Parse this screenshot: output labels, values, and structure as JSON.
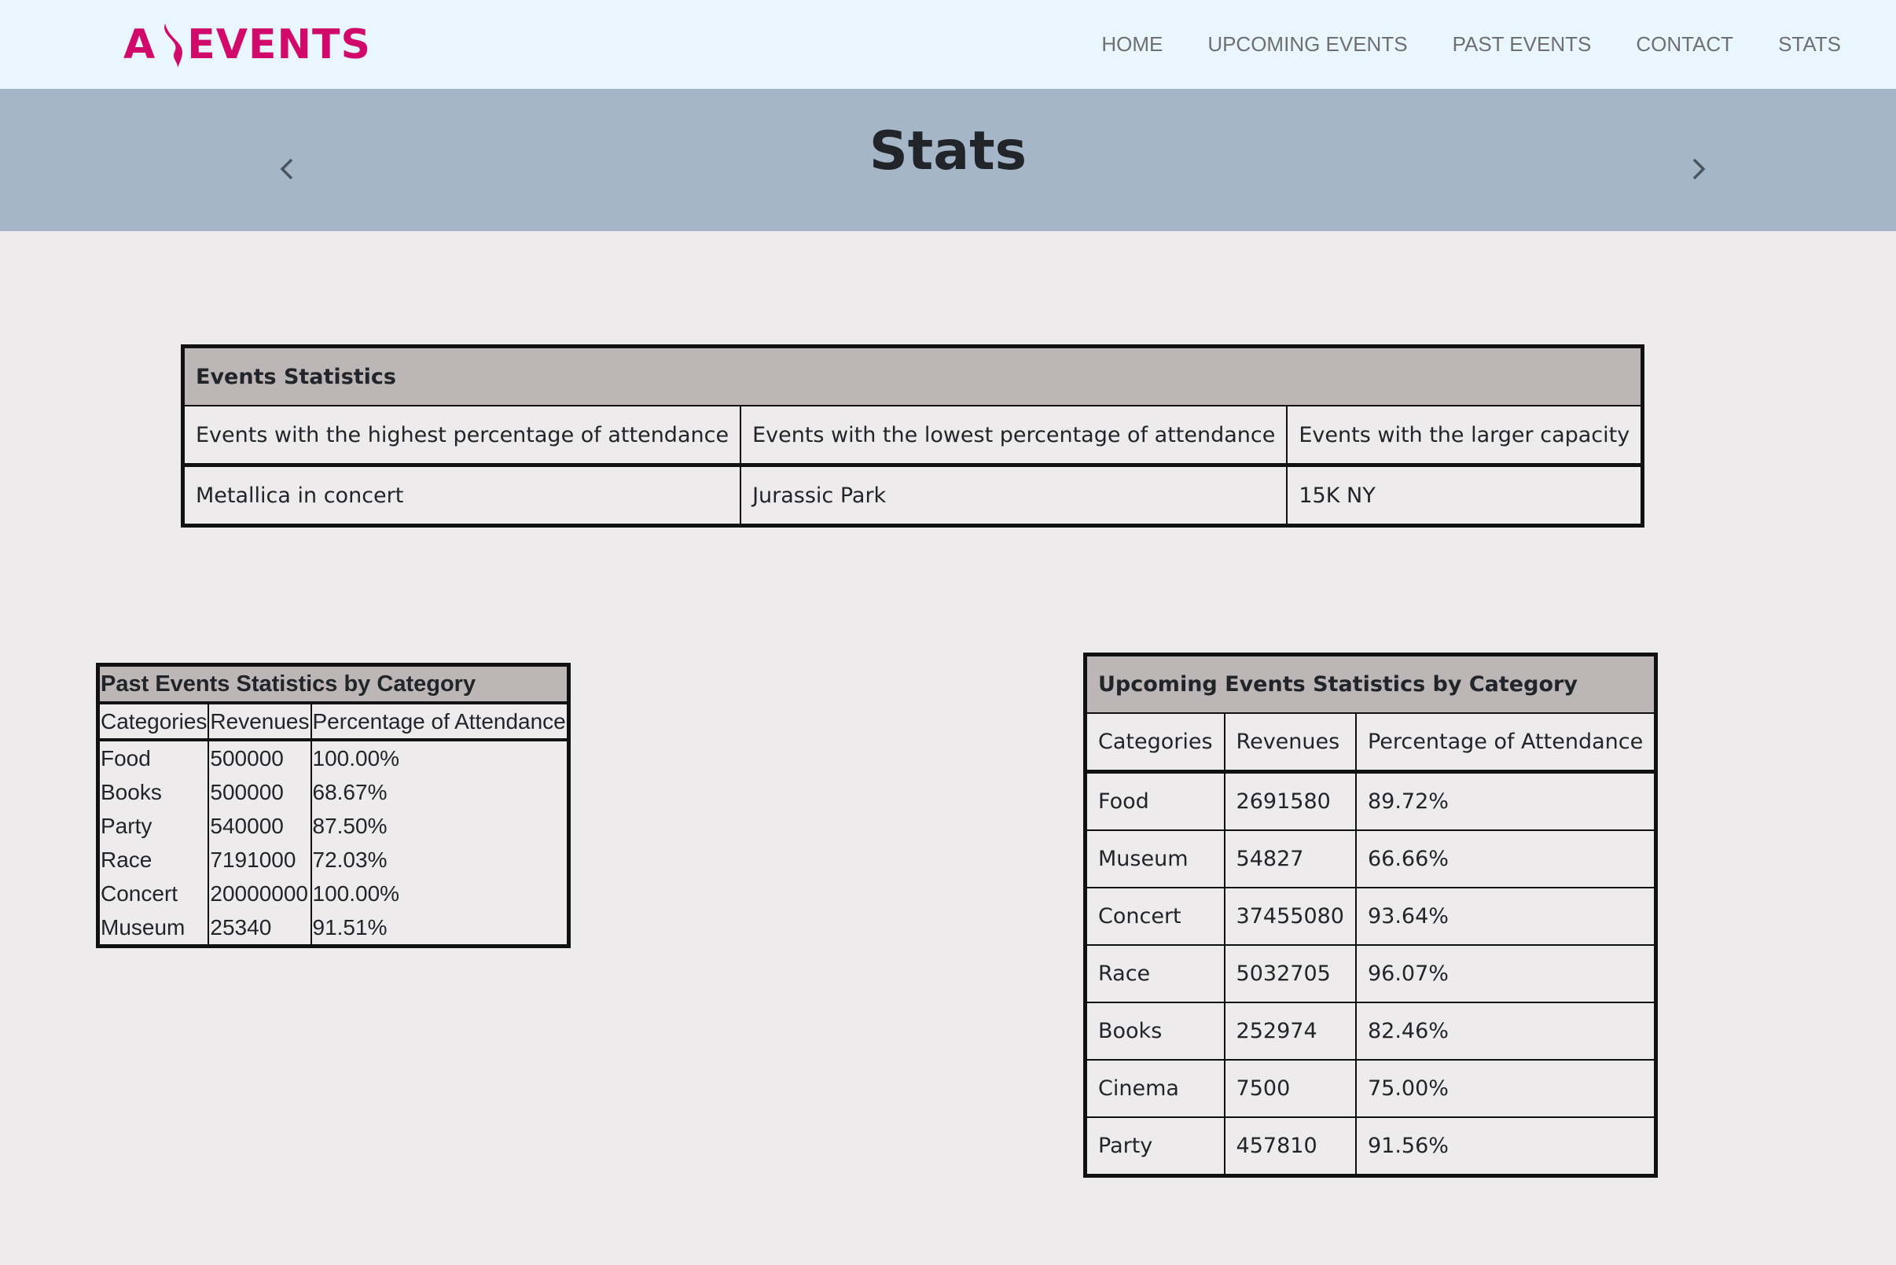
{
  "nav": {
    "logo_left": "A",
    "logo_right": "EVENTS",
    "brand_color": "#d1096b",
    "links": [
      "HOME",
      "UPCOMING EVENTS",
      "PAST EVENTS",
      "CONTACT",
      "STATS"
    ]
  },
  "banner": {
    "title": "Stats",
    "prev_icon": "chevron-left-icon",
    "next_icon": "chevron-right-icon"
  },
  "events_stats": {
    "title": "Events Statistics",
    "headers": [
      "Events with the highest percentage of attendance",
      "Events with the lowest percentage of attendance",
      "Events with the larger capacity"
    ],
    "values": [
      "Metallica in concert",
      "Jurassic Park",
      "15K NY"
    ]
  },
  "past_stats": {
    "title": "Past Events Statistics by Category",
    "headers": [
      "Categories",
      "Revenues",
      "Percentage of Attendance"
    ],
    "rows": [
      [
        "Food",
        "500000",
        "100.00%"
      ],
      [
        "Books",
        "500000",
        "68.67%"
      ],
      [
        "Party",
        "540000",
        "87.50%"
      ],
      [
        "Race",
        "7191000",
        "72.03%"
      ],
      [
        "Concert",
        "20000000",
        "100.00%"
      ],
      [
        "Museum",
        "25340",
        "91.51%"
      ]
    ]
  },
  "upcoming_stats": {
    "title": "Upcoming Events Statistics by Category",
    "headers": [
      "Categories",
      "Revenues",
      "Percentage of Attendance"
    ],
    "rows": [
      [
        "Food",
        "2691580",
        "89.72%"
      ],
      [
        "Museum",
        "54827",
        "66.66%"
      ],
      [
        "Concert",
        "37455080",
        "93.64%"
      ],
      [
        "Race",
        "5032705",
        "96.07%"
      ],
      [
        "Books",
        "252974",
        "82.46%"
      ],
      [
        "Cinema",
        "7500",
        "75.00%"
      ],
      [
        "Party",
        "457810",
        "91.56%"
      ]
    ]
  }
}
